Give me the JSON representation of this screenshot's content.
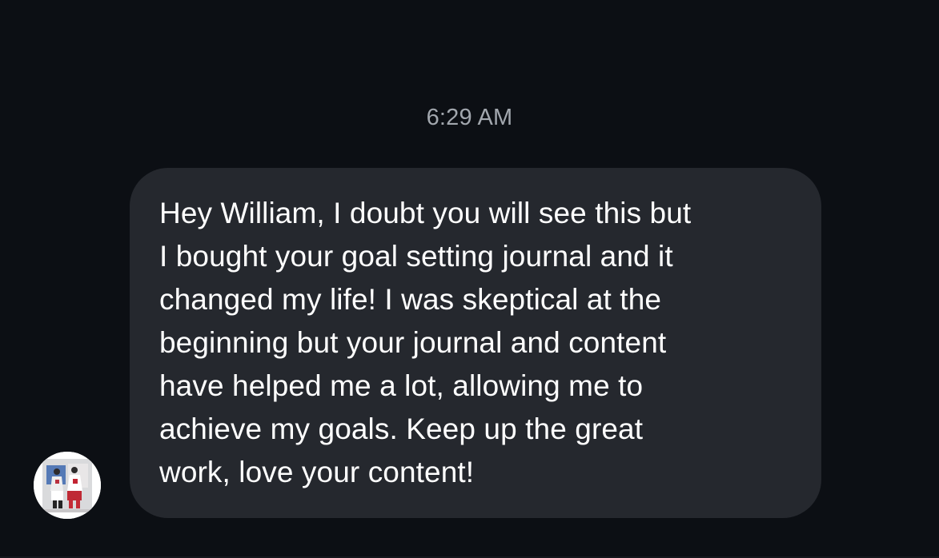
{
  "thread": {
    "timestamp": "6:29 AM"
  },
  "message": {
    "text": "Hey William, I doubt you will see this but\nI bought your goal setting journal and it\nchanged my life! I was skeptical at the\nbeginning but your journal and content\nhave helped me a lot, allowing me to\nachieve my goals. Keep up the great\nwork, love your content!"
  },
  "sender": {
    "avatar_icon": "profile-photo-icon"
  },
  "colors": {
    "background": "#0c0f14",
    "bubble": "#25282e",
    "timestamp": "#a2a7ae",
    "text": "#ffffff"
  }
}
